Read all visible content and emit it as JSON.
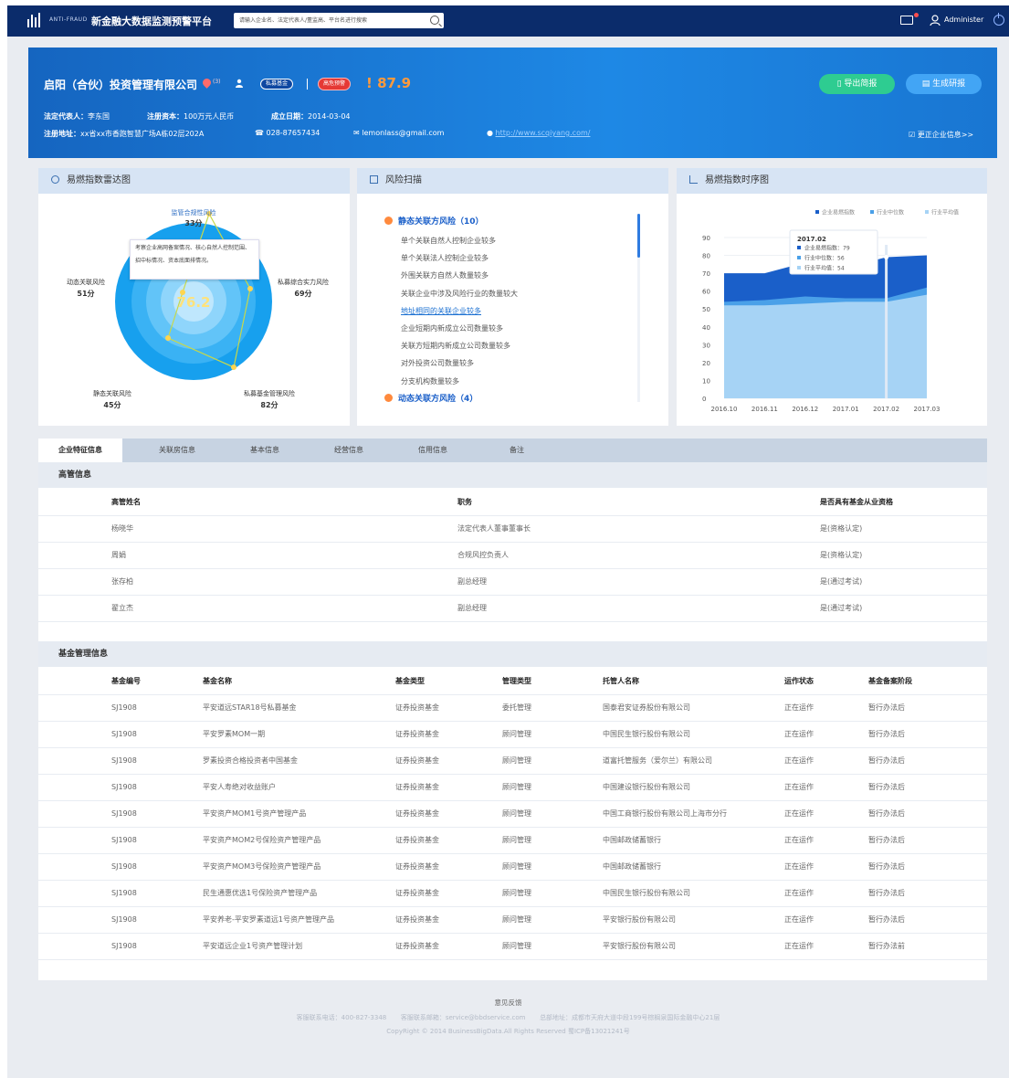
{
  "topbar": {
    "brand_en": "ANTI-FRAUD",
    "brand_cn": "新金融大数据监测预警平台",
    "search_placeholder": "请输入企业名、法定代表人/董监高、平台名进行搜索",
    "admin_label": "Administer"
  },
  "company": {
    "name": "启阳（合伙）投资管理有限公司",
    "pin_count": "(3)",
    "tag_private_fund": "私募基金",
    "tag_risk": "高危预警",
    "score": "87.9",
    "export_button": "导出简报",
    "report_button": "生成研报",
    "legal_rep_label": "法定代表人：",
    "legal_rep": "李东国",
    "capital_label": "注册资本：",
    "capital": "100万元人民币",
    "founded_label": "成立日期：",
    "founded": "2014-03-04",
    "address_label": "注册地址：",
    "address": "xx省xx市香跑智慧广场A栋02层202A",
    "phone": "028-87657434",
    "email": "lemonlass@gmail.com",
    "website": "http://www.scqiyang.com/",
    "correct_link": "更正企业信息>>"
  },
  "panels": {
    "radar_title": "易燃指数雷达图",
    "scan_title": "风险扫描",
    "timeseries_title": "易燃指数时序图"
  },
  "radar": {
    "center_score": "76.2",
    "tooltip": "考察企业高网备案情况、核心自然人控制范围、招中标情况、资本底面排情况。",
    "labels": [
      {
        "name": "监管合规性风险",
        "score": "33分"
      },
      {
        "name": "私募综合实力风险",
        "score": "69分"
      },
      {
        "name": "私募基金管理风险",
        "score": "82分"
      },
      {
        "name": "静态关联风险",
        "score": "45分"
      },
      {
        "name": "动态关联风险",
        "score": "51分"
      }
    ]
  },
  "scan": {
    "static_title": "静态关联方风险（10）",
    "static_items": [
      "单个关联自然人控制企业较多",
      "单个关联法人控制企业较多",
      "外围关联方自然人数量较多",
      "关联企业中涉及风险行业的数量较大",
      "地址相同的关联企业较多",
      "企业短期内新成立公司数量较多",
      "关联方短期内新成立公司数量较多",
      "对外投资公司数量较多",
      "分支机构数量较多"
    ],
    "dynamic_title": "动态关联方风险（4）"
  },
  "chart_data": {
    "type": "area",
    "title": "",
    "x": [
      "2016.10",
      "2016.11",
      "2016.12",
      "2017.01",
      "2017.02",
      "2017.03"
    ],
    "ylim": [
      0,
      90
    ],
    "yticks": [
      "0",
      "10",
      "20",
      "30",
      "40",
      "50",
      "60",
      "70",
      "80",
      "90"
    ],
    "legend_position": "top-right",
    "series": [
      {
        "name": "企业易燃指数",
        "color": "#1a5fc9",
        "values": [
          70,
          70,
          76,
          73,
          79,
          80
        ]
      },
      {
        "name": "行业中位数",
        "color": "#4aa0e8",
        "values": [
          54,
          55,
          57,
          56,
          56,
          62
        ]
      },
      {
        "name": "行业平均值",
        "color": "#a6d3f5",
        "values": [
          52,
          52,
          53,
          54,
          54,
          58
        ]
      }
    ],
    "tooltip": {
      "title": "2017.02",
      "lines": [
        "企业易燃指数：79",
        "行业中位数：56",
        "行业平均值：54"
      ]
    }
  },
  "tabs": [
    "企业特征信息",
    "关联房信息",
    "基本信息",
    "经营信息",
    "信用信息",
    "备注"
  ],
  "executives": {
    "title": "高管信息",
    "headers": [
      "高管姓名",
      "职务",
      "是否具有基金从业资格"
    ],
    "rows": [
      [
        "杨晓华",
        "法定代表人董事董事长",
        "是(资格认定)"
      ],
      [
        "周娟",
        "合规风控负责人",
        "是(资格认定)"
      ],
      [
        "张存柏",
        "副总经理",
        "是(通过考试)"
      ],
      [
        "翟立杰",
        "副总经理",
        "是(通过考试)"
      ]
    ]
  },
  "funds": {
    "title": "基金管理信息",
    "headers": [
      "基金编号",
      "基金名称",
      "基金类型",
      "管理类型",
      "托管人名称",
      "运作状态",
      "基金备案阶段"
    ],
    "rows": [
      [
        "SJ1908",
        "平安道远STAR18号私募基金",
        "证券投资基金",
        "委托管理",
        "国泰君安证券股份有限公司",
        "正在运作",
        "暂行办法后"
      ],
      [
        "SJ1908",
        "平安罗素MOM一期",
        "证券投资基金",
        "顾问管理",
        "中国民生银行股份有限公司",
        "正在运作",
        "暂行办法后"
      ],
      [
        "SJ1908",
        "罗素投资合格投资者中国基金",
        "证券投资基金",
        "顾问管理",
        "道富托管服务（爱尔兰）有限公司",
        "正在运作",
        "暂行办法后"
      ],
      [
        "SJ1908",
        "平安人寿绝对收益账户",
        "证券投资基金",
        "顾问管理",
        "中国建设银行股份有限公司",
        "正在运作",
        "暂行办法后"
      ],
      [
        "SJ1908",
        "平安资产MOM1号资产管理产品",
        "证券投资基金",
        "顾问管理",
        "中国工商银行股份有限公司上海市分行",
        "正在运作",
        "暂行办法后"
      ],
      [
        "SJ1908",
        "平安资产MOM2号保险资产管理产品",
        "证券投资基金",
        "顾问管理",
        "中国邮政储蓄银行",
        "正在运作",
        "暂行办法后"
      ],
      [
        "SJ1908",
        "平安资产MOM3号保险资产管理产品",
        "证券投资基金",
        "顾问管理",
        "中国邮政储蓄银行",
        "正在运作",
        "暂行办法后"
      ],
      [
        "SJ1908",
        "民生通惠优选1号保险资产管理产品",
        "证券投资基金",
        "顾问管理",
        "中国民生银行股份有限公司",
        "正在运作",
        "暂行办法后"
      ],
      [
        "SJ1908",
        "平安养老-平安罗素道远1号资产管理产品",
        "证券投资基金",
        "顾问管理",
        "平安银行股份有限公司",
        "正在运作",
        "暂行办法后"
      ],
      [
        "SJ1908",
        "平安道远企业1号资产管理计划",
        "证券投资基金",
        "顾问管理",
        "平安银行股份有限公司",
        "正在运作",
        "暂行办法前"
      ]
    ]
  },
  "footer": {
    "feedback": "意见反馈",
    "phone": "客服联系电话：400-827-3348",
    "email": "客服联系邮箱：service@bbdservice.com",
    "address": "总部地址：成都市天府大道中段199号棕榈泉国际金融中心21层",
    "copyright": "CopyRight © 2014 BusinessBigData.All Rights Reserved 蜀ICP备13021241号"
  }
}
